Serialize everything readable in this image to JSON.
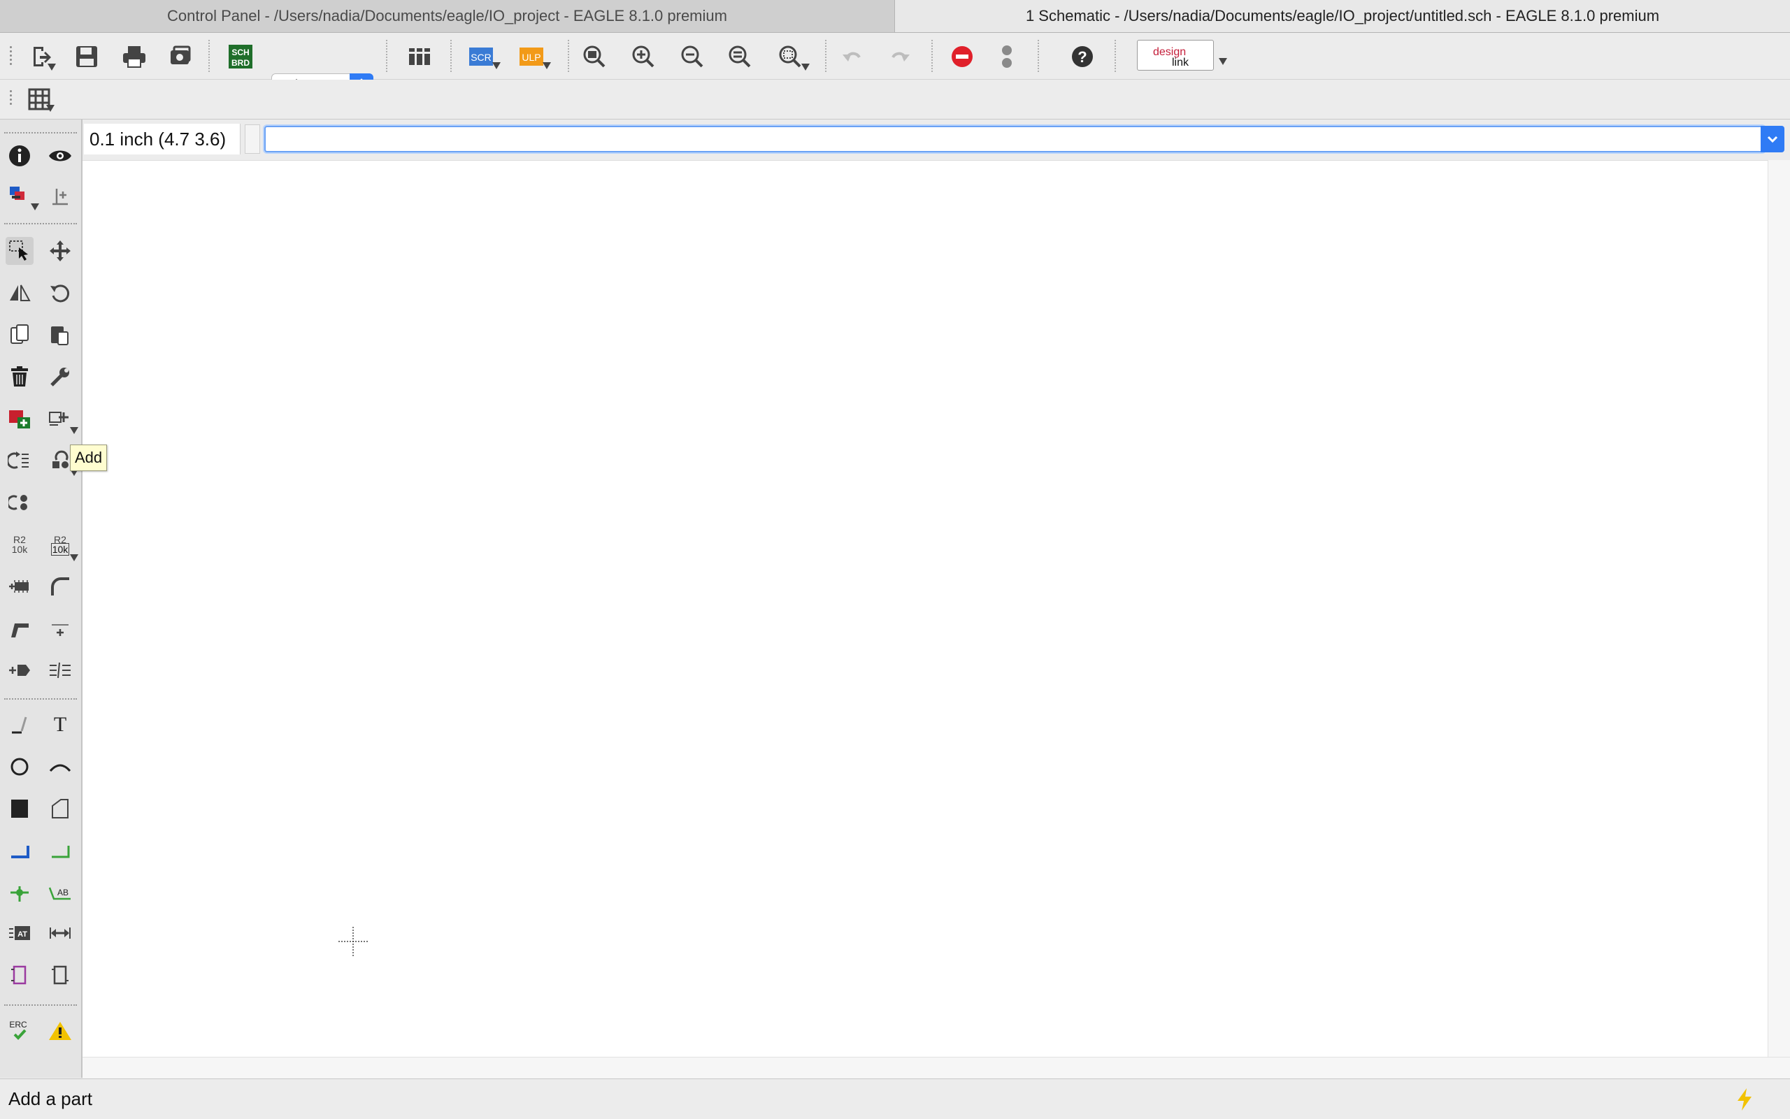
{
  "tabs": [
    {
      "label": "Control Panel - /Users/nadia/Documents/eagle/IO_project - EAGLE 8.1.0 premium"
    },
    {
      "label": "1 Schematic - /Users/nadia/Documents/eagle/IO_project/untitled.sch - EAGLE 8.1.0 premium"
    }
  ],
  "toolbar": {
    "sheet_value": "1/1",
    "sch_brd_label": [
      "SCH",
      "BRD"
    ],
    "scr_label": "SCR",
    "ulp_label": "ULP",
    "design_link": [
      "design",
      "link"
    ],
    "icons": [
      "open-icon",
      "save-icon",
      "print-icon",
      "cam-icon",
      "sch-brd-switch-icon",
      "sheet-spinner",
      "library-icon",
      "script-icon",
      "ulp-icon",
      "zoom-fit-icon",
      "zoom-in-icon",
      "zoom-out-icon",
      "zoom-redraw-icon",
      "zoom-select-icon",
      "undo-icon",
      "redo-icon",
      "stop-icon",
      "go-icon",
      "help-icon",
      "design-link-icon",
      "grid-icon"
    ]
  },
  "coordinate_display": "0.1 inch (4.7 3.6)",
  "command_input": {
    "value": "",
    "placeholder": ""
  },
  "tooltip": "Add",
  "status_message": "Add a part",
  "sidebar_mini_labels": {
    "value_r2": "R2",
    "value_10k": "10k",
    "text_t": "T",
    "ab": "AB",
    "at": "AT",
    "erc": "ERC"
  },
  "colors": {
    "accent_blue": "#2f7bf5",
    "stop_red": "#e0202a",
    "warning_yellow": "#f2c200",
    "net_green": "#3aa33a"
  }
}
